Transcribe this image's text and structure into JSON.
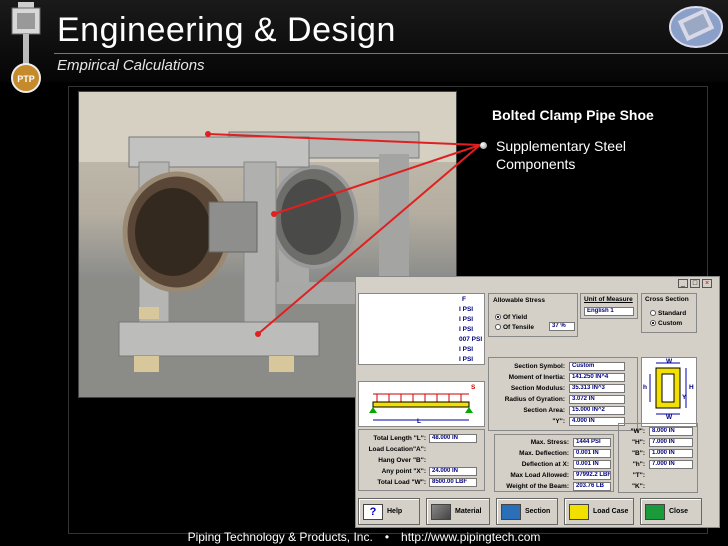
{
  "header": {
    "title": "Engineering & Design",
    "subtitle": "Empirical Calculations"
  },
  "bullets": {
    "title": "Bolted Clamp Pipe Shoe",
    "items": [
      "Supplementary Steel Components"
    ]
  },
  "software": {
    "allowable_stress": {
      "label": "Allowable Stress",
      "options": [
        "Of Yield",
        "Of Tensile"
      ],
      "selected": "Of Yield",
      "value": "37 %"
    },
    "unit_of_measure": {
      "label": "Unit of Measure",
      "value": "English 1"
    },
    "cross_section": {
      "label": "Cross Section",
      "options": [
        "Standard",
        "Custom"
      ],
      "selected": "Custom"
    },
    "psi_list": [
      "F",
      "I PSI",
      "I PSI",
      "I PSI",
      "007 PSI",
      "I PSI",
      "I PSI"
    ],
    "section_props": [
      {
        "label": "Section Symbol:",
        "value": "Custom"
      },
      {
        "label": "Moment of Inertia:",
        "value": "141.250 IN^4"
      },
      {
        "label": "Section Modulus:",
        "value": "35.313 IN^3"
      },
      {
        "label": "Radius of Gyration:",
        "value": "3.072 IN"
      },
      {
        "label": "Section Area:",
        "value": "15.000 IN^2"
      },
      {
        "label": "\"Y\":",
        "value": "4.000 IN"
      }
    ],
    "dims": [
      {
        "label": "\"W\":",
        "value": "8.000 IN"
      },
      {
        "label": "\"H\":",
        "value": "7.000 IN"
      },
      {
        "label": "\"B\":",
        "value": "1.000 IN"
      },
      {
        "label": "\"h\":",
        "value": "7.000 IN"
      },
      {
        "label": "\"T\":",
        "value": ""
      },
      {
        "label": "\"K\":",
        "value": ""
      }
    ],
    "load_inputs": [
      {
        "label": "Total Length \"L\":",
        "value": "48.000 IN"
      },
      {
        "label": "Load Location\"A\":",
        "value": ""
      },
      {
        "label": "Hang Over \"B\":",
        "value": ""
      },
      {
        "label": "Any point \"X\":",
        "value": "24.000 IN"
      },
      {
        "label": "Total Load \"W\":",
        "value": "8500.00 LBF"
      }
    ],
    "results": [
      {
        "label": "Max. Stress:",
        "value": "1444 PSI"
      },
      {
        "label": "Max. Deflection:",
        "value": "0.001 IN"
      },
      {
        "label": "Deflection at X:",
        "value": "0.001 IN"
      },
      {
        "label": "Max Load Allowed:",
        "value": "97992.2 LBF"
      },
      {
        "label": "Weight of the Beam:",
        "value": "203.76 LB"
      }
    ],
    "diagram_labels": {
      "s": "S",
      "l": "L",
      "w_top": "W",
      "w_bot": "W",
      "h": "H",
      "h2": "h",
      "y": "Y"
    },
    "window_buttons": [
      "_",
      "□",
      "×"
    ],
    "toolbar": [
      "Help",
      "Material",
      "Section",
      "Load Case",
      "Close"
    ]
  },
  "footer": {
    "company": "Piping Technology & Products, Inc.",
    "separator": "•",
    "url": "http://www.pipingtech.com"
  }
}
